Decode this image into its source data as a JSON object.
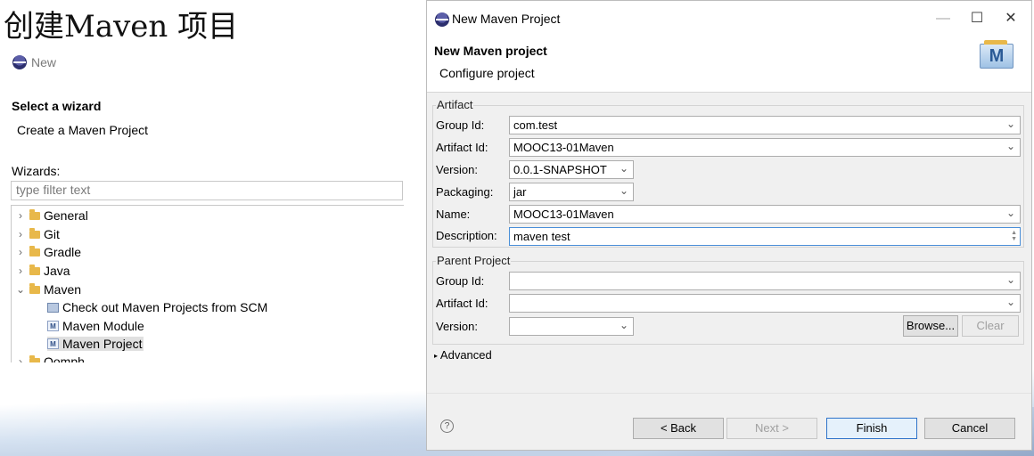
{
  "slide": {
    "title": "创建Maven 项目"
  },
  "left": {
    "header": "New",
    "wizard_title": "Select a wizard",
    "wizard_subtitle": "Create a Maven Project",
    "wizards_label": "Wizards:",
    "filter_placeholder": "type filter text",
    "tree": [
      {
        "label": "General",
        "expanded": false
      },
      {
        "label": "Git",
        "expanded": false
      },
      {
        "label": "Gradle",
        "expanded": false
      },
      {
        "label": "Java",
        "expanded": false
      },
      {
        "label": "Maven",
        "expanded": true
      },
      {
        "label": "Check out Maven Projects from SCM"
      },
      {
        "label": "Maven Module"
      },
      {
        "label": "Maven Project",
        "selected": true
      },
      {
        "label": "Oomph"
      }
    ]
  },
  "dialog": {
    "window_title": "New Maven Project",
    "heading": "New Maven project",
    "subheading": "Configure project",
    "badge": "M",
    "artifact": {
      "group_label": "Artifact",
      "group_id_label": "Group Id:",
      "group_id_value": "com.test",
      "artifact_id_label": "Artifact Id:",
      "artifact_id_value": "MOOC13-01Maven",
      "version_label": "Version:",
      "version_value": "0.0.1-SNAPSHOT",
      "packaging_label": "Packaging:",
      "packaging_value": "jar",
      "name_label": "Name:",
      "name_value": "MOOC13-01Maven",
      "description_label": "Description:",
      "description_value": "maven test"
    },
    "parent": {
      "group_label": "Parent Project",
      "group_id_label": "Group Id:",
      "group_id_value": "",
      "artifact_id_label": "Artifact Id:",
      "artifact_id_value": "",
      "version_label": "Version:",
      "version_value": "",
      "browse_label": "Browse...",
      "clear_label": "Clear"
    },
    "advanced_label": "Advanced",
    "buttons": {
      "back": "< Back",
      "next": "Next >",
      "finish": "Finish",
      "cancel": "Cancel"
    },
    "help_glyph": "?"
  }
}
